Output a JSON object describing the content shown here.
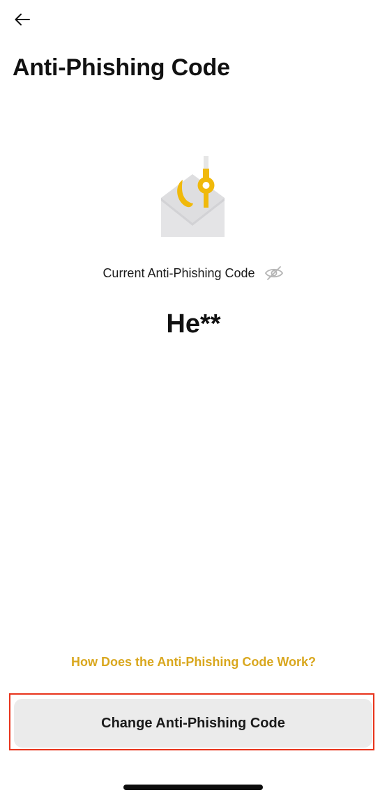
{
  "header": {
    "title": "Anti-Phishing Code",
    "back_icon": "arrow-left-icon"
  },
  "illustration": {
    "icon": "envelope-with-fishhooks-icon",
    "colors": {
      "envelope": "#dedee0",
      "hook_accent": "#f0b90b",
      "line": "#e6e6e6"
    }
  },
  "current_code": {
    "label": "Current Anti-Phishing Code",
    "visibility_icon": "eye-slash-icon",
    "value": "He**"
  },
  "help": {
    "link_text": "How Does the Anti-Phishing Code Work?",
    "color": "#d9a71e"
  },
  "actions": {
    "change_label": "Change Anti-Phishing Code",
    "highlight_color": "#e8341c"
  }
}
